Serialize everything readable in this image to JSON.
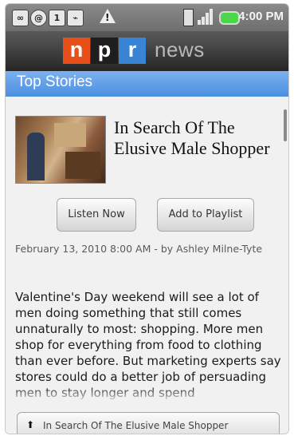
{
  "status_bar": {
    "icons": [
      "voicemail-icon",
      "at-sign-icon",
      "calendar-icon",
      "usb-icon",
      "warning-icon",
      "phone-icon",
      "signal-icon",
      "battery-icon"
    ],
    "time": "4:00 PM",
    "battery_color": "#4cd64c"
  },
  "header": {
    "logo_letters": [
      "n",
      "p",
      "r"
    ],
    "logo_colors": [
      "#e8501b",
      "#1e1e1e",
      "#3a84d6"
    ],
    "app_name": "news"
  },
  "section": {
    "title": "Top Stories"
  },
  "story": {
    "title": "In Search Of The Elusive Male Shopper",
    "buttons": {
      "listen": "Listen Now",
      "playlist": "Add to Playlist"
    },
    "byline": "February 13, 2010 8:00 AM - by Ashley Milne-Tyte",
    "body": "Valentine's Day weekend will see a lot of men doing something that still comes unnaturally to most: shopping. More men shop for everything from food to clothing than ever before. But marketing experts say stores could do a better job of persuading men to stay longer and spend"
  },
  "bottom_bar": {
    "label": "In Search Of The Elusive Male Shopper"
  }
}
